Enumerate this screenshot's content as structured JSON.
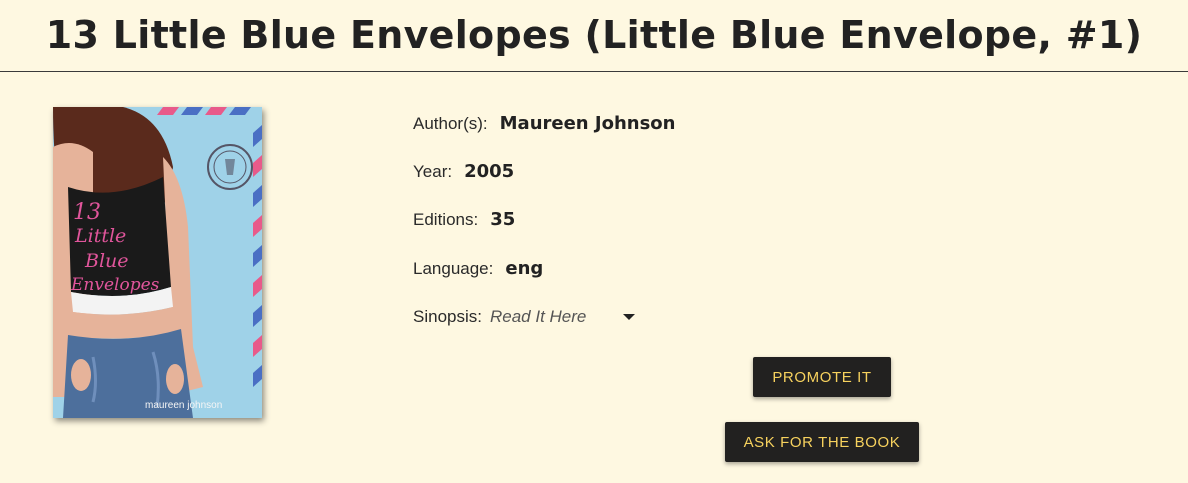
{
  "book": {
    "title": "13 Little Blue Envelopes (Little Blue Envelope, #1)",
    "cover": {
      "title_lines": [
        "13",
        "Little",
        "Blue",
        "Envelopes"
      ],
      "author": "maureen johnson",
      "colors": {
        "sky": "#9fd2e8",
        "top": "#1a1a1a",
        "title_pink": "#e0559b",
        "jeans": "#4d6f9c",
        "skin": "#e6b39a",
        "hair": "#5a2a1c"
      }
    }
  },
  "details": {
    "author": {
      "label": "Author(s):",
      "value": "Maureen Johnson"
    },
    "year": {
      "label": "Year:",
      "value": "2005"
    },
    "editions": {
      "label": "Editions:",
      "value": "35"
    },
    "language": {
      "label": "Language:",
      "value": "eng"
    },
    "synopsis": {
      "label": "Sinopsis:",
      "link": "Read It Here"
    }
  },
  "actions": {
    "promote": "PROMOTE IT",
    "ask": "ASK FOR THE BOOK"
  },
  "colors": {
    "background": "#fef8e1",
    "button_bg": "#222120",
    "button_text": "#f7d25e"
  }
}
